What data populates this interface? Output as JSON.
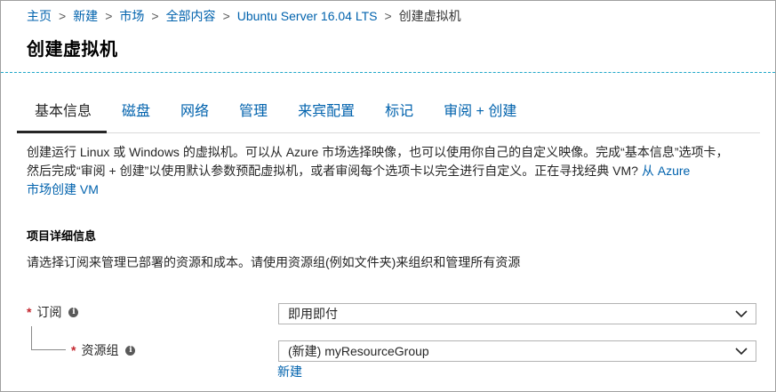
{
  "breadcrumb": {
    "items": [
      "主页",
      "新建",
      "市场",
      "全部内容",
      "Ubuntu Server 16.04 LTS"
    ],
    "current": "创建虚拟机",
    "separator": ">"
  },
  "page": {
    "title": "创建虚拟机"
  },
  "tabs": [
    {
      "label": "基本信息",
      "active": true
    },
    {
      "label": "磁盘",
      "active": false
    },
    {
      "label": "网络",
      "active": false
    },
    {
      "label": "管理",
      "active": false
    },
    {
      "label": "来宾配置",
      "active": false
    },
    {
      "label": "标记",
      "active": false
    },
    {
      "label": "审阅 + 创建",
      "active": false
    }
  ],
  "description": {
    "line1": "创建运行 Linux 或 Windows 的虚拟机。可以从 Azure 市场选择映像，也可以使用你自己的自定义映像。完成“基本信息”选项卡，",
    "line2_text": "然后完成“审阅 + 创建”以使用默认参数预配虚拟机，或者审阅每个选项卡以完全进行自定义。正在寻找经典 VM? ",
    "line2_link": "从 Azure",
    "line3_link": "市场创建 VM"
  },
  "project_details": {
    "title": "项目详细信息",
    "description": "请选择订阅来管理已部署的资源和成本。请使用资源组(例如文件夹)来组织和管理所有资源"
  },
  "fields": {
    "subscription": {
      "required_mark": "*",
      "label": "订阅",
      "info_icon": "i",
      "value": "即用即付"
    },
    "resource_group": {
      "required_mark": "*",
      "label": "资源组",
      "info_icon": "i",
      "value": "(新建) myResourceGroup",
      "create_new_link": "新建"
    }
  },
  "colors": {
    "link": "#0062ad",
    "required": "#c4262e",
    "header_divider": "#1fa7c9",
    "border": "#b3b3b3"
  },
  "icons": {
    "dropdown": "chevron-down-icon",
    "info": "info-icon",
    "separator": "chevron-right-icon"
  }
}
